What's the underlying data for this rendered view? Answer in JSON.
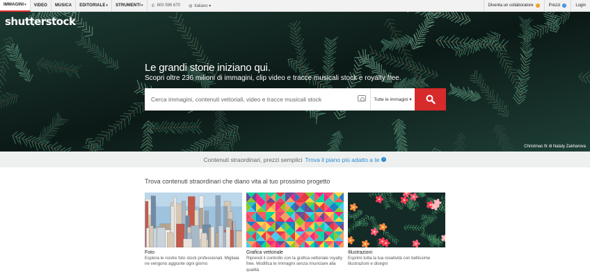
{
  "topnav": {
    "items": [
      {
        "label": "IMMAGINI",
        "caret": "▾"
      },
      {
        "label": "VIDEO",
        "caret": ""
      },
      {
        "label": "MUSICA",
        "caret": ""
      },
      {
        "label": "EDITORIALE",
        "caret": "▾"
      },
      {
        "label": "STRUMENTI",
        "caret": "▾"
      }
    ],
    "phone": "800 596 670",
    "language": "Italiano ▾",
    "contributor": "Diventa un collaboratore",
    "pricing": "Prezzi",
    "login": "Login"
  },
  "hero": {
    "logo": "shutterstock",
    "headline": "Le grandi storie iniziano qui.",
    "subline": "Scopri oltre 236 milioni di immagini, clip video e tracce musicali stock e royalty free.",
    "search_placeholder": "Cerca immagini, contenuti vettoriali, video e tracce musicali stock",
    "filter": "Tutte le immagini ▾",
    "credit": "Christmas fir di Nataly Zakharova"
  },
  "promo": {
    "text": "Contenuti straordinari, prezzi semplici",
    "link": "Trova il piano più adatto a te"
  },
  "section": {
    "title": "Trova contenuti straordinari che diano vita al tuo prossimo progetto",
    "cards": [
      {
        "title": "Foto",
        "desc": "Esplora le nostre foto stock professionali. Migliaia ne vengono aggiunte ogni giorno"
      },
      {
        "title": "Grafica vettoriale",
        "desc": "Riprendi il controllo con la grafica vettoriale royalty free. Modifica le immagini senza rinunciare alla qualità"
      },
      {
        "title": "Illustrazioni",
        "desc": "Esprimi tutta la tua creatività con bellissime illustrazioni e disegni"
      }
    ]
  },
  "colors": {
    "accent": "#d72a2a",
    "link": "#2a8ad0",
    "bg_strip": "#eef0f0"
  }
}
